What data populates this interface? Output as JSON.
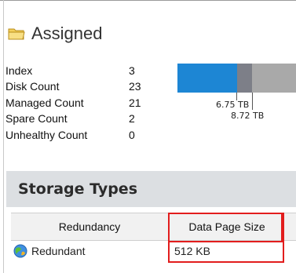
{
  "panel": {
    "title": "Assigned",
    "icon": "folder-icon"
  },
  "properties": [
    {
      "label": "Index",
      "value": "3"
    },
    {
      "label": "Disk Count",
      "value": "23"
    },
    {
      "label": "Managed Count",
      "value": "21"
    },
    {
      "label": "Spare Count",
      "value": "2"
    },
    {
      "label": "Unhealthy Count",
      "value": "0"
    }
  ],
  "capacity": {
    "used_label": "6.75 TB",
    "total_label": "8.72 TB",
    "colors": {
      "used": "#1d86d4",
      "allocated": "#7d7f88",
      "free": "#a9a9a9"
    }
  },
  "storage_types": {
    "title": "Storage Types",
    "columns": [
      "Redundancy",
      "Data Page Size"
    ],
    "rows": [
      {
        "redundancy": "Redundant",
        "data_page_size": "512 KB",
        "icon": "globe-icon"
      }
    ],
    "highlight_color": "#e21d1d"
  }
}
